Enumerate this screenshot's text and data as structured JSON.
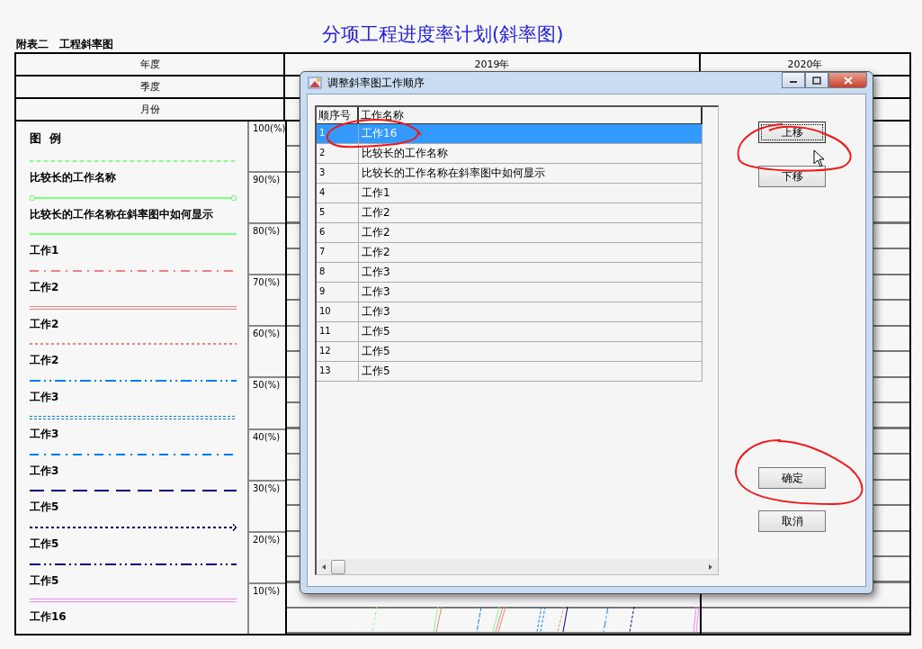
{
  "page_title": "分项工程进度率计划(斜率图)",
  "sheet_caption": "附表二　工程斜率图",
  "header": {
    "year_label": "年度",
    "quarter_label": "季度",
    "month_label": "月份",
    "years": [
      "2019年",
      "2020年"
    ]
  },
  "legend": {
    "title": "图  例",
    "items": [
      {
        "label": "比较长的工作名称",
        "kind": "dashed",
        "color": "#80ff80"
      },
      {
        "label": "比较长的工作名称在斜率图中如何显示",
        "kind": "circles",
        "color": "#80ff80"
      },
      {
        "label": "工作1",
        "kind": "solid",
        "color": "#80ff80"
      },
      {
        "label": "工作2",
        "kind": "dashdot",
        "color": "#f08080"
      },
      {
        "label": "工作2",
        "kind": "double",
        "color": "#f08080"
      },
      {
        "label": "工作2",
        "kind": "dotted",
        "color": "#f08080"
      },
      {
        "label": "工作3",
        "kind": "dashdotdot",
        "color": "#0080ff"
      },
      {
        "label": "工作3",
        "kind": "doubledotted",
        "color": "#0080ff"
      },
      {
        "label": "工作3",
        "kind": "dashdot",
        "color": "#0080ff"
      },
      {
        "label": "工作5",
        "kind": "longdash",
        "color": "#000080"
      },
      {
        "label": "工作5",
        "kind": "arrow",
        "color": "#000080"
      },
      {
        "label": "工作5",
        "kind": "dashdotdot",
        "color": "#000080"
      },
      {
        "label": "工作16",
        "kind": "double",
        "color": "#ff80ff"
      }
    ]
  },
  "percent_labels": [
    "100(%)",
    "90(%)",
    "80(%)",
    "70(%)",
    "60(%)",
    "50(%)",
    "40(%)",
    "30(%)",
    "20(%)",
    "10(%)"
  ],
  "dialog": {
    "title": "调整斜率图工作顺序",
    "columns": [
      "顺序号",
      "工作名称"
    ],
    "rows": [
      {
        "no": "1",
        "name": "工作16",
        "selected": true
      },
      {
        "no": "2",
        "name": "比较长的工作名称",
        "selected": false
      },
      {
        "no": "3",
        "name": "比较长的工作名称在斜率图中如何显示",
        "selected": false
      },
      {
        "no": "4",
        "name": "工作1",
        "selected": false
      },
      {
        "no": "5",
        "name": "工作2",
        "selected": false
      },
      {
        "no": "6",
        "name": "工作2",
        "selected": false
      },
      {
        "no": "7",
        "name": "工作2",
        "selected": false
      },
      {
        "no": "8",
        "name": "工作3",
        "selected": false
      },
      {
        "no": "9",
        "name": "工作3",
        "selected": false
      },
      {
        "no": "10",
        "name": "工作3",
        "selected": false
      },
      {
        "no": "11",
        "name": "工作5",
        "selected": false
      },
      {
        "no": "12",
        "name": "工作5",
        "selected": false
      },
      {
        "no": "13",
        "name": "工作5",
        "selected": false
      }
    ],
    "buttons": [
      {
        "label": "上移",
        "focused": true
      },
      {
        "label": "下移",
        "focused": false
      },
      {
        "label": "确定",
        "focused": false
      },
      {
        "label": "取消",
        "focused": false
      }
    ]
  }
}
